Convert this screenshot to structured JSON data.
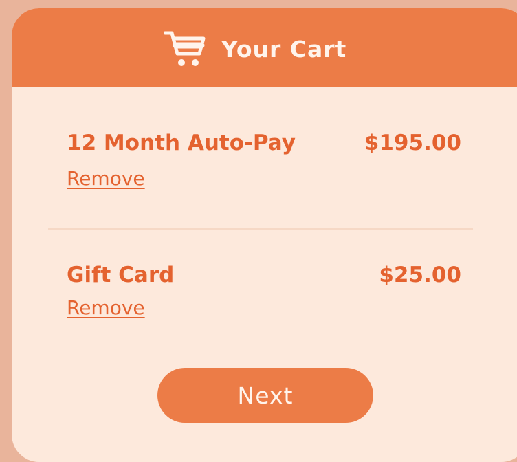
{
  "header": {
    "icon": "shopping-cart-icon",
    "title": "Your Cart"
  },
  "cart": {
    "items": [
      {
        "name": "12 Month Auto-Pay",
        "price": "$195.00",
        "remove_label": "Remove"
      },
      {
        "name": "Gift Card",
        "price": "$25.00",
        "remove_label": "Remove"
      }
    ]
  },
  "actions": {
    "next_label": "Next"
  },
  "colors": {
    "accent": "#ec7c47",
    "text": "#e4622f",
    "card_bg": "#fde9dc",
    "page_bg": "#e9b49b"
  }
}
